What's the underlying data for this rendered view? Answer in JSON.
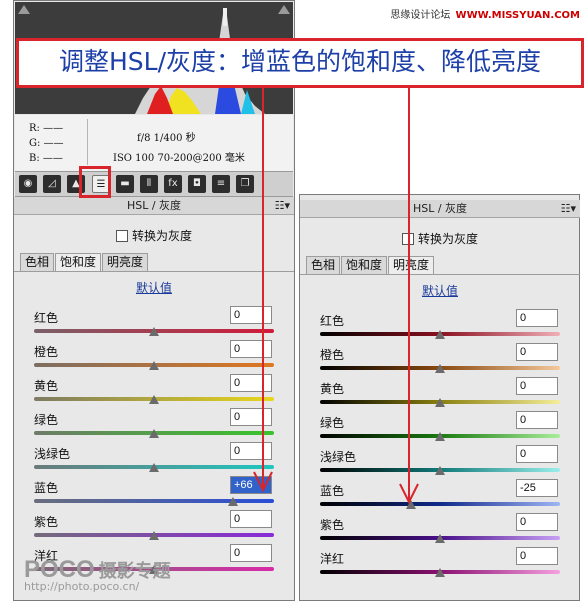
{
  "watermark_top": {
    "text": "思缘设计论坛",
    "site": "WWW.MISSYUAN.COM"
  },
  "banner_text": "调整HSL/灰度：增蓝色的饱和度、降低亮度",
  "info": {
    "r": "R:",
    "g": "G:",
    "b": "B:",
    "dash": "——",
    "exposure": "f/8  1/400 秒",
    "iso": "ISO 100   70-200@200 毫米"
  },
  "toolbar_icons": [
    "aperture-icon",
    "tone-curve-icon",
    "detail-icon",
    "hsl-icon",
    "split-toning-icon",
    "lens-icon",
    "fx-icon",
    "camera-calibration-icon",
    "presets-icon",
    "snapshots-icon"
  ],
  "panel_left": {
    "title": "HSL / 灰度",
    "menu": "☷▾",
    "convert_gray": "转换为灰度",
    "tabs": [
      "色相",
      "饱和度",
      "明亮度"
    ],
    "active_tab": 1,
    "default_label": "默认值",
    "sliders": [
      {
        "label": "红色",
        "value": "0",
        "pos": 0.5,
        "gradient": "linear-gradient(to right,#7a6068,#d11a3a)"
      },
      {
        "label": "橙色",
        "value": "0",
        "pos": 0.5,
        "gradient": "linear-gradient(to right,#7c6e62,#e07720)"
      },
      {
        "label": "黄色",
        "value": "0",
        "pos": 0.5,
        "gradient": "linear-gradient(to right,#7c7a62,#e8d71a)"
      },
      {
        "label": "绿色",
        "value": "0",
        "pos": 0.5,
        "gradient": "linear-gradient(to right,#6e7c68,#38c42a)"
      },
      {
        "label": "浅绿色",
        "value": "0",
        "pos": 0.5,
        "gradient": "linear-gradient(to right,#6a7a7a,#20c6c0)"
      },
      {
        "label": "蓝色",
        "value": "+66",
        "pos": 0.83,
        "gradient": "linear-gradient(to right,#6a6e7c,#2a4ed8)",
        "highlight": true
      },
      {
        "label": "紫色",
        "value": "0",
        "pos": 0.5,
        "gradient": "linear-gradient(to right,#746a7c,#8a2ad8)"
      },
      {
        "label": "洋红",
        "value": "0",
        "pos": 0.5,
        "gradient": "linear-gradient(to right,#7c6a76,#d82aa8)"
      }
    ]
  },
  "panel_right": {
    "title": "HSL / 灰度",
    "menu": "☷▾",
    "convert_gray": "转换为灰度",
    "tabs": [
      "色相",
      "饱和度",
      "明亮度"
    ],
    "active_tab": 2,
    "default_label": "默认值",
    "sliders": [
      {
        "label": "红色",
        "value": "0",
        "pos": 0.5,
        "gradient": "linear-gradient(to right,#000,#8a1020,#f0b0b8)"
      },
      {
        "label": "橙色",
        "value": "0",
        "pos": 0.5,
        "gradient": "linear-gradient(to right,#000,#8a4a10,#f5c89a)"
      },
      {
        "label": "黄色",
        "value": "0",
        "pos": 0.5,
        "gradient": "linear-gradient(to right,#000,#8a8010,#f5ee9a)"
      },
      {
        "label": "绿色",
        "value": "0",
        "pos": 0.5,
        "gradient": "linear-gradient(to right,#000,#1a7a10,#a8ee9a)"
      },
      {
        "label": "浅绿色",
        "value": "0",
        "pos": 0.5,
        "gradient": "linear-gradient(to right,#000,#107a78,#9aeeea)"
      },
      {
        "label": "蓝色",
        "value": "-25",
        "pos": 0.38,
        "gradient": "linear-gradient(to right,#000,#102a8a,#a0b4f5)"
      },
      {
        "label": "紫色",
        "value": "0",
        "pos": 0.5,
        "gradient": "linear-gradient(to right,#000,#4a108a,#c8a0f5)"
      },
      {
        "label": "洋红",
        "value": "0",
        "pos": 0.5,
        "gradient": "linear-gradient(to right,#000,#8a1070,#f5a0e0)"
      }
    ]
  },
  "watermark_bottom": {
    "brand": "POCO",
    "sub": "摄影专题",
    "url": "http://photo.poco.cn/"
  },
  "colors": {
    "accent": "#d8242b",
    "banner_text": "#1d3fa8"
  }
}
